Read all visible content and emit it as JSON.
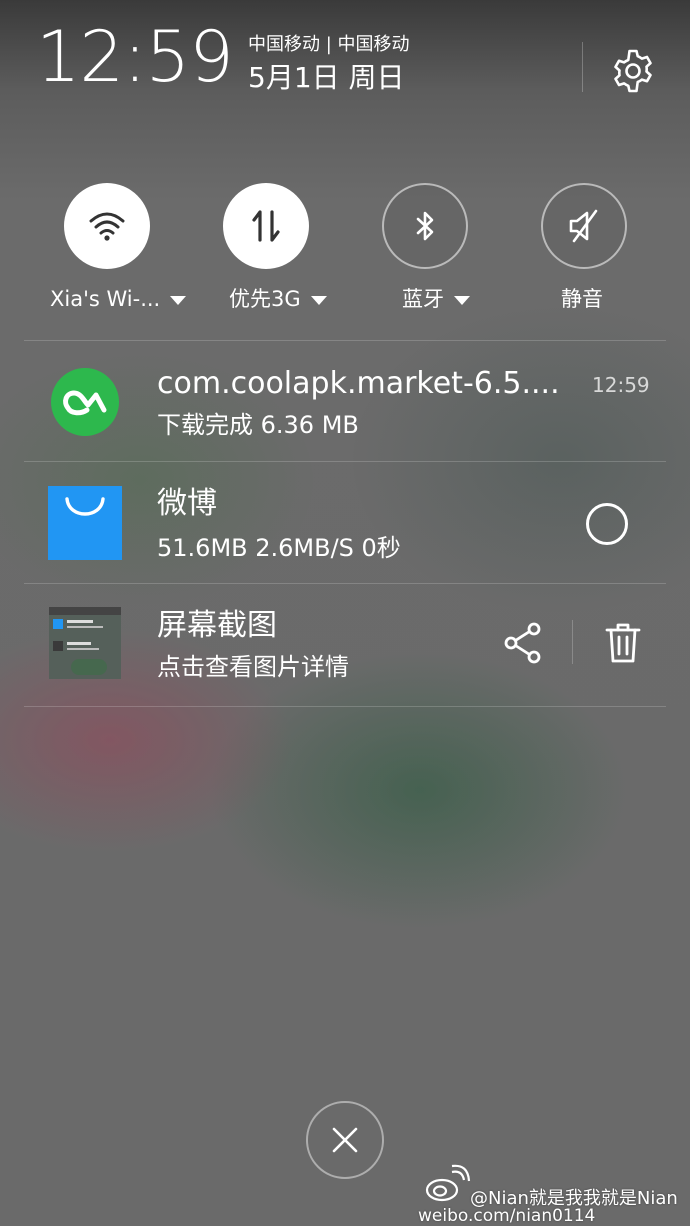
{
  "status": {
    "time": "12:59",
    "carriers": "中国移动 | 中国移动",
    "date": "5月1日 周日"
  },
  "toggles": [
    {
      "label": "Xia's Wi-...",
      "state": "on",
      "icon": "wifi-icon",
      "dropdown": true
    },
    {
      "label": "优先3G",
      "state": "on",
      "icon": "mobile-data-icon",
      "dropdown": true
    },
    {
      "label": "蓝牙",
      "state": "off",
      "icon": "bluetooth-icon",
      "dropdown": true
    },
    {
      "label": "静音",
      "state": "off",
      "icon": "mute-icon",
      "dropdown": false
    }
  ],
  "notifications": [
    {
      "app_icon": "coolapk-icon",
      "title": "com.coolapk.market-6.5....",
      "subtitle": "下载完成   6.36 MB",
      "time": "12:59",
      "accent": "#2db84d"
    },
    {
      "app_icon": "weibo-bag-icon",
      "title": "微博",
      "subtitle": "51.6MB   2.6MB/S   0秒",
      "accent": "#2196f3"
    },
    {
      "app_icon": "screenshot-thumbnail",
      "title": "屏幕截图",
      "subtitle": "点击查看图片详情"
    }
  ],
  "watermark": {
    "line1": "@Nian就是我我就是Nian",
    "line2": "weibo.com/nian0114"
  }
}
